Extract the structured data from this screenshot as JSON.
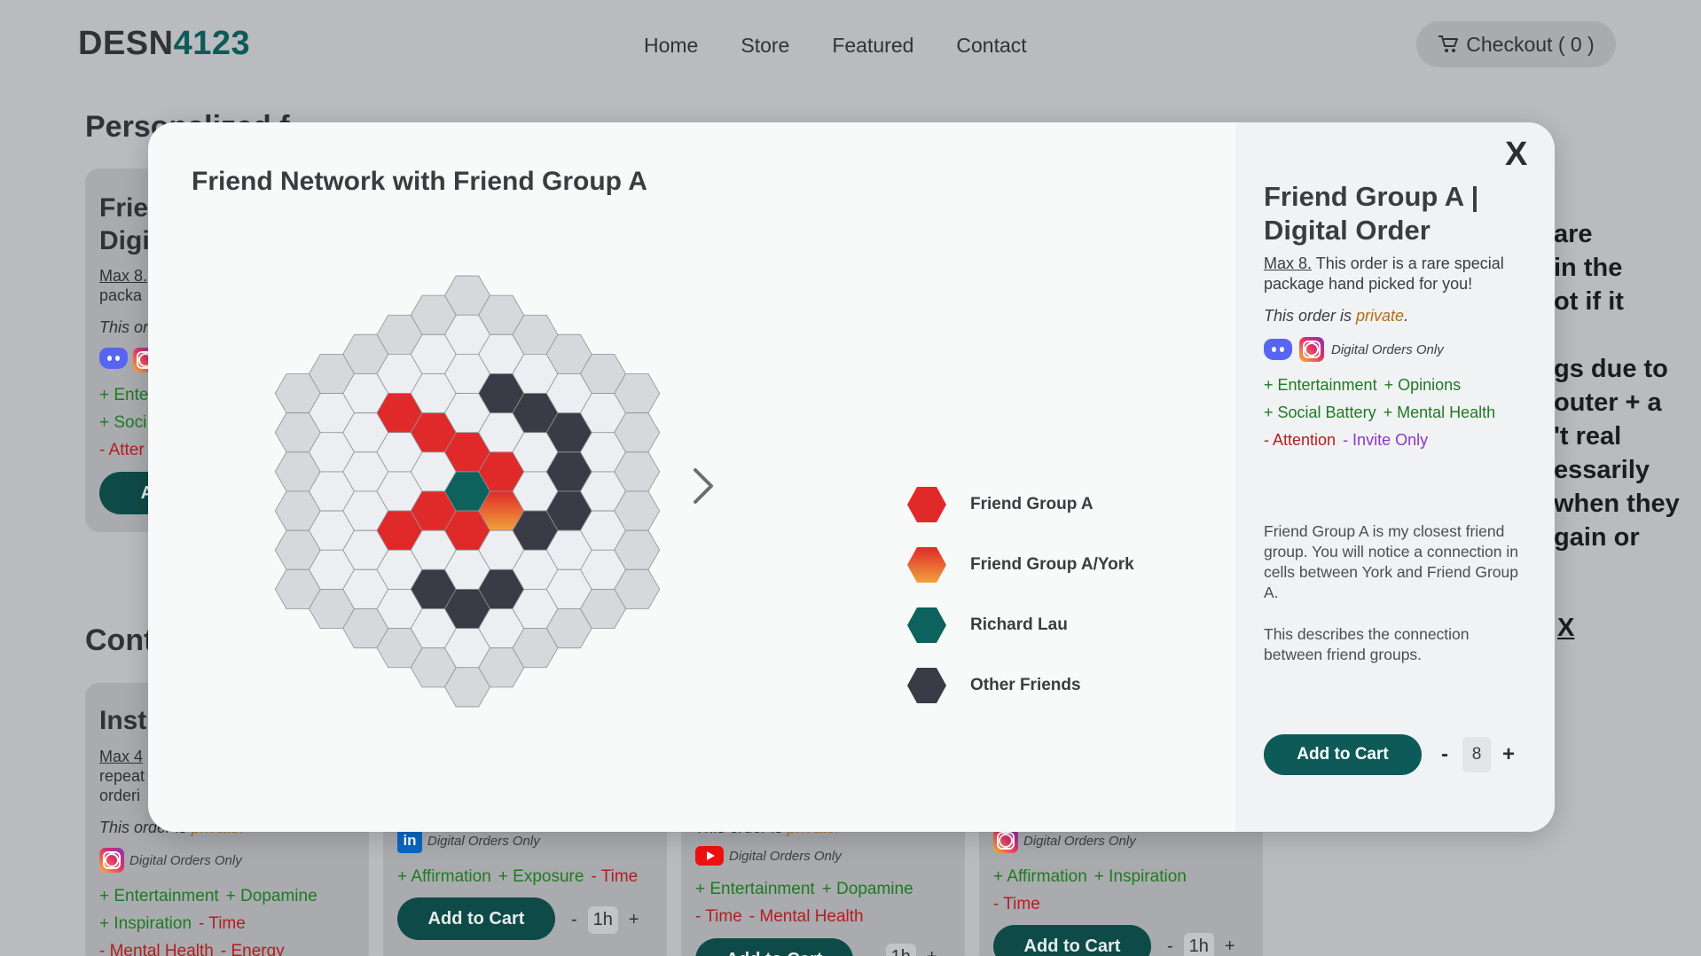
{
  "nav": {
    "logo_text": "DESN",
    "logo_number": "4123",
    "links": [
      "Home",
      "Store",
      "Featured",
      "Contact"
    ],
    "checkout": "Checkout ( 0 )"
  },
  "background": {
    "section1_title": "Personalized f",
    "section2_title": "Cont",
    "card1": {
      "title_line1": "Frie",
      "title_line2": "Digi",
      "max": "Max 8.",
      "desc": "packa",
      "private": "This or",
      "tag1": "+ Ente",
      "tag2": "+ Soci",
      "tag3": "- Atter",
      "button": "Ad"
    },
    "card2": {
      "title": "Inst",
      "max": "Max 4",
      "desc1": "repeat",
      "desc2": "orderi",
      "private_prefix": "This order is ",
      "private_word": "private.",
      "digital": "Digital Orders Only",
      "tags": [
        "+ Entertainment",
        "+ Dopamine"
      ],
      "tags2_plus": "+ Inspiration",
      "tags2_minus": "- Time",
      "tags3": [
        "- Mental Health",
        "- Energy"
      ]
    },
    "card3": {
      "digital": "Digital Orders Only",
      "tag_plus": [
        "+ Affirmation",
        "+ Exposure"
      ],
      "tag_minus": "- Time",
      "button": "Add to Cart",
      "qty": "1h"
    },
    "card4": {
      "private_prefix": "This order is ",
      "private_word": "private.",
      "digital": "Digital Orders Only",
      "tag_plus": [
        "+ Entertainment",
        "+ Dopamine"
      ],
      "tag_minus": [
        "- Time",
        "- Mental Health"
      ],
      "button": "Add to Cart",
      "qty": "1h"
    },
    "card5": {
      "digital": "Digital Orders Only",
      "tag_plus": [
        "+ Affirmation",
        "+ Inspiration"
      ],
      "tag_minus": "- Time",
      "button": "Add to Cart",
      "qty": "1h"
    },
    "right_text": [
      "are",
      "in the",
      "ot if it",
      "gs due to",
      "outer + a",
      "'t real",
      "essarily",
      "when they",
      "gain or"
    ],
    "right_x": "X"
  },
  "modal": {
    "title": "Friend Network with Friend Group A",
    "legend": [
      {
        "label": "Friend Group A",
        "color": "#e02a2a"
      },
      {
        "label": "Friend Group A/York",
        "color": "gradient-red-orange"
      },
      {
        "label": "Richard Lau",
        "color": "#0d625e"
      },
      {
        "label": "Other Friends",
        "color": "#393c46"
      }
    ],
    "close": "X",
    "product": {
      "title": "Friend Group A | Digital Order",
      "max": "Max 8.",
      "desc": " This order is a rare special package hand picked for you!",
      "private_prefix": "This order is ",
      "private_word": "private",
      "private_suffix": ".",
      "digital": "Digital Orders Only",
      "tags_row1": [
        "+ Entertainment",
        "+ Opinions"
      ],
      "tags_row2": [
        "+ Social Battery",
        "+ Mental Health"
      ],
      "tags_row3_minus": "- Attention",
      "tags_row3_invite": "- Invite Only",
      "description1": "Friend Group A is my closest friend group. You will notice a connection in cells between York and Friend Group A.",
      "description2": "This describes the connection between friend groups.",
      "add_to_cart": "Add to Cart",
      "qty_minus": "-",
      "qty_value": "8",
      "qty_plus": "+"
    },
    "hex_grid": {
      "radius": 5,
      "colors": {
        "empty": "#eceef1",
        "edge": "#d6d8dc",
        "red": "#e02a2a",
        "york": "gradient",
        "richard": "#0d625e",
        "other": "#393c46"
      }
    }
  }
}
